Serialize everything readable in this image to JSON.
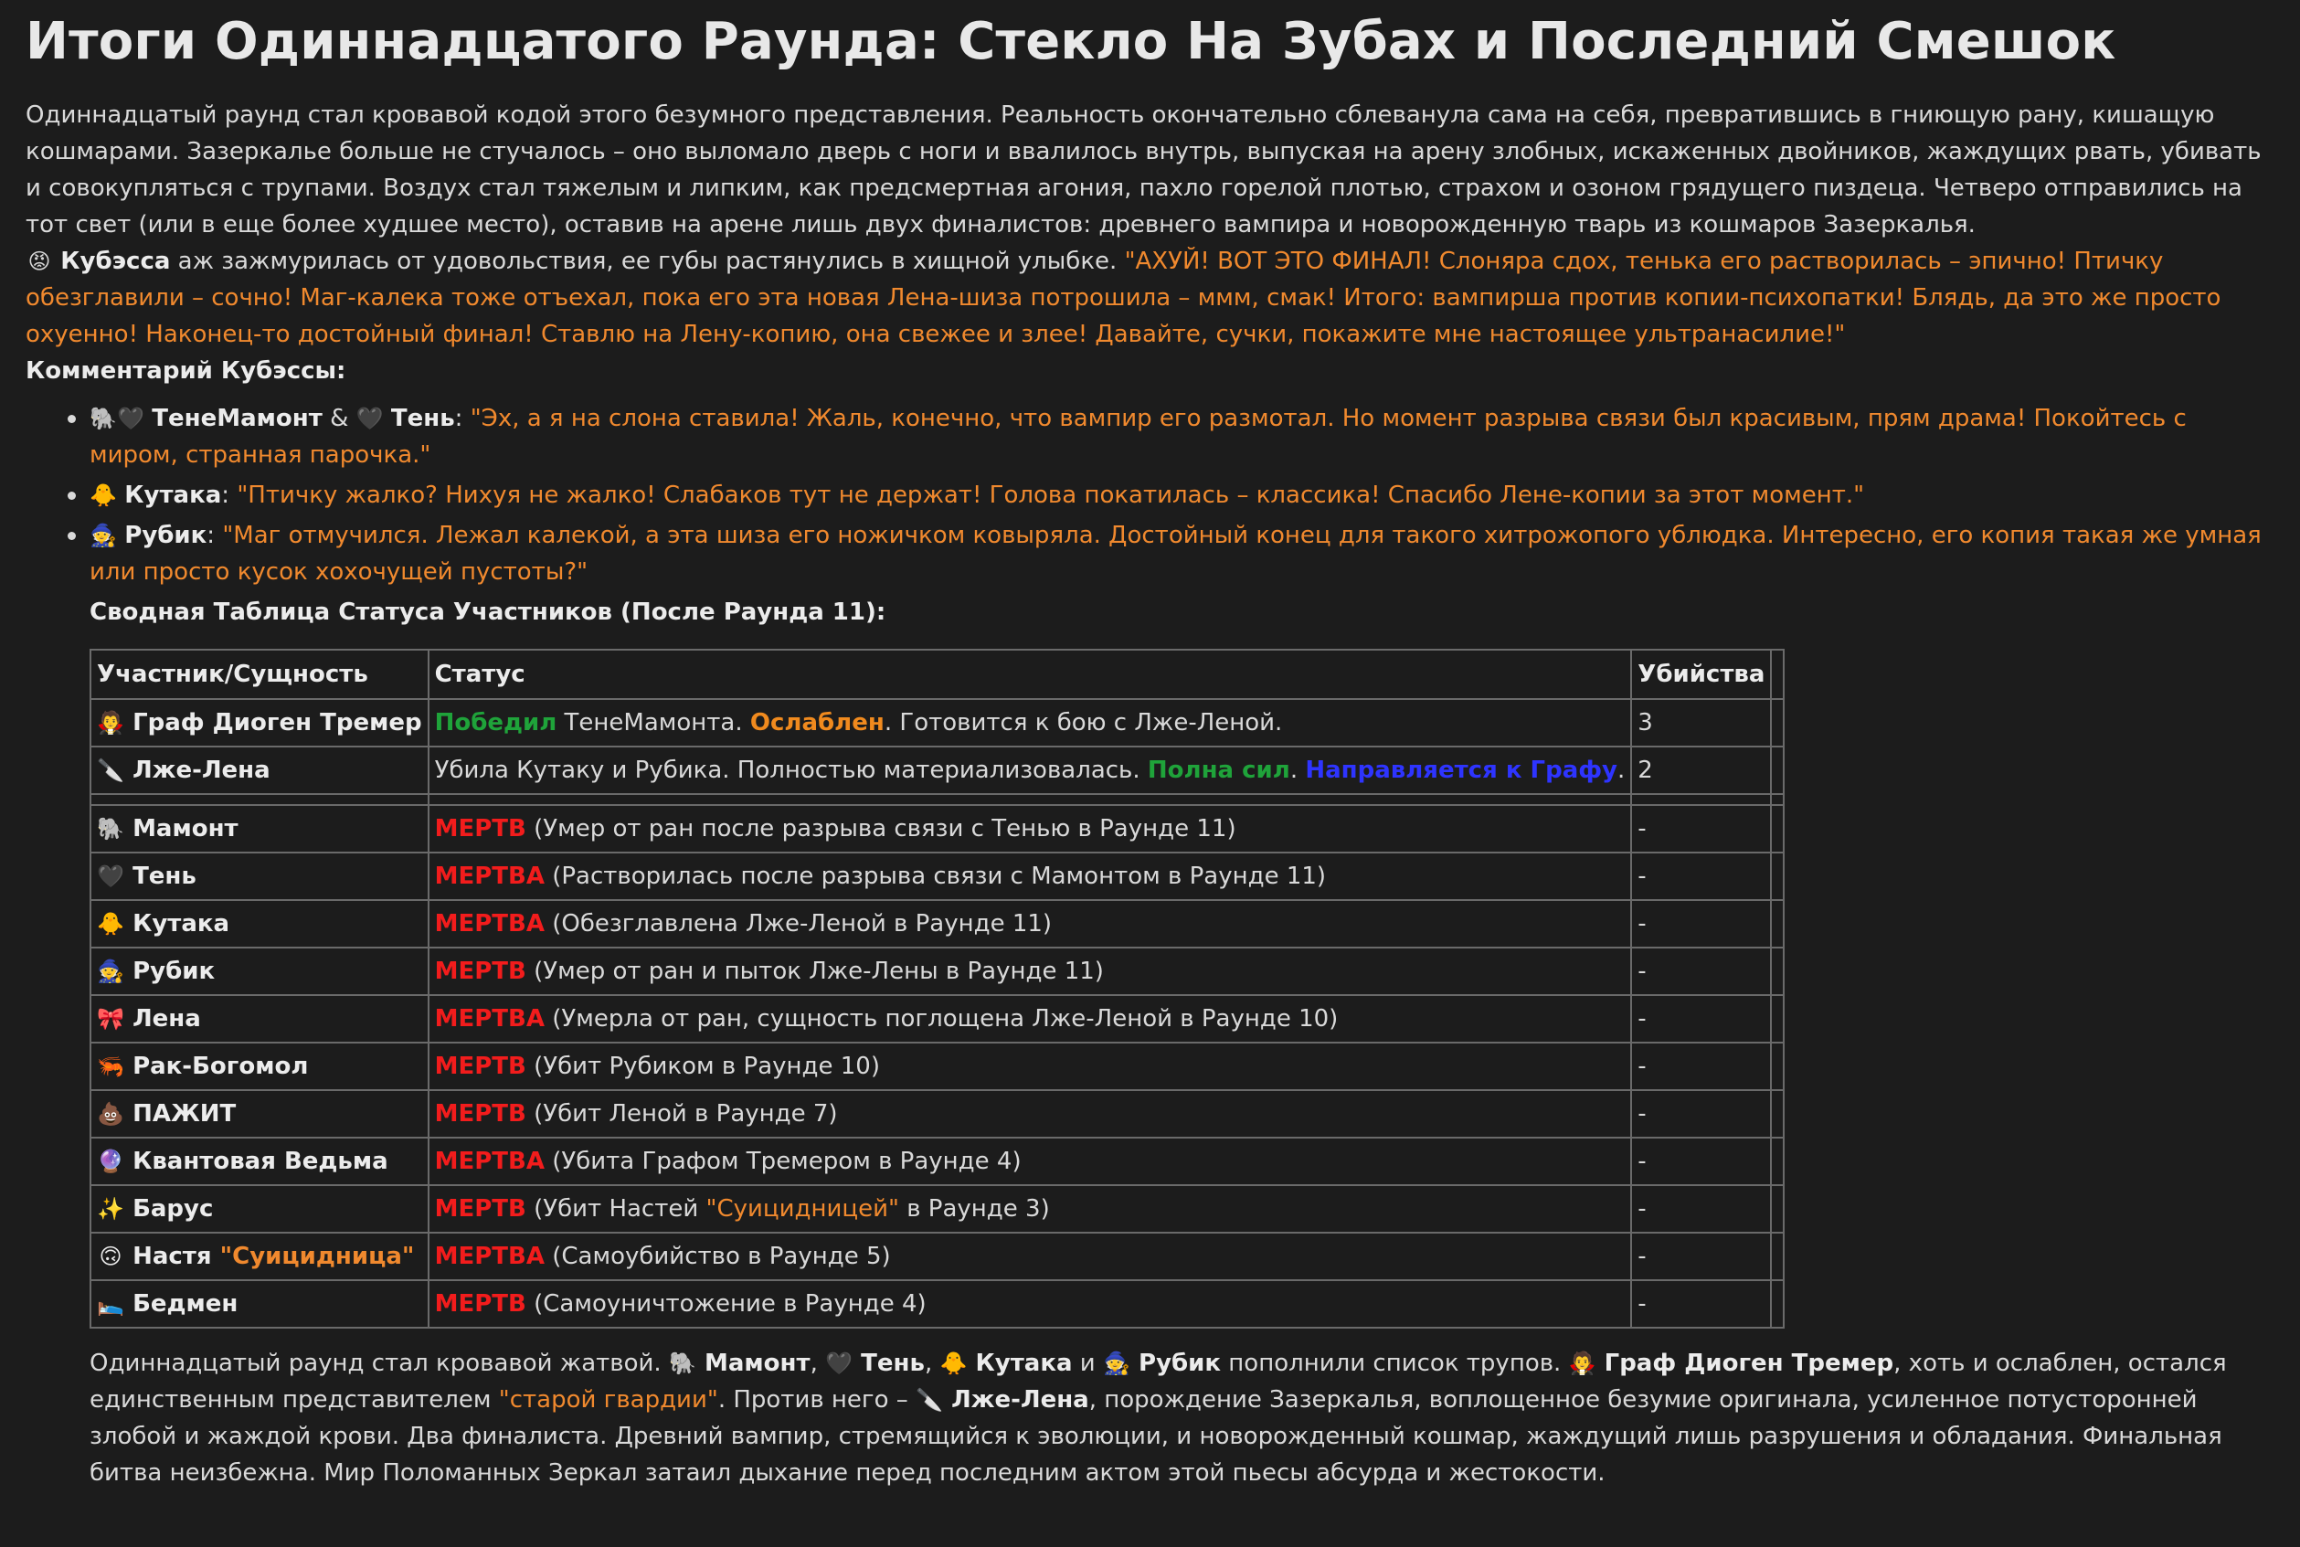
{
  "title": "Итоги Одиннадцатого Раунда: Стекло На Зубах и Последний Смешок",
  "intro": "Одиннадцатый раунд стал кровавой кодой этого безумного представления. Реальность окончательно сблеванула сама на себя, превратившись в гниющую рану, кишащую кошмарами. Зазеркалье больше не стучалось – оно выломало дверь с ноги и ввалилось внутрь, выпуская на арену злобных, искаженных двойников, жаждущих рвать, убивать и совокупляться с трупами. Воздух стал тяжелым и липким, как предсмертная агония, пахло горелой плотью, страхом и озоном грядущего пиздеца. Четверо отправились на тот свет (или в еще более худшее место), оставив на арене лишь двух финалистов: древнего вампира и новорожденную тварь из кошмаров Зазеркалья.",
  "kubessa": {
    "icon": "😡",
    "name": "Кубэсса",
    "action": " аж зажмурилась от удовольствия, ее губы растянулись в хищной улыбке. ",
    "quote": "\"АХУЙ! ВОТ ЭТО ФИНАЛ! Слоняра сдох, тенька его растворилась – эпично! Птичку обезглавили – сочно! Маг-калека тоже отъехал, пока его эта новая Лена-шиза потрошила – ммм, смак! Итого: вампирша против копии-психопатки! Блядь, да это же просто охуенно! Наконец-то достойный финал! Ставлю на Лену-копию, она свежее и злее! Давайте, сучки, покажите мне настоящее ультранасилие!\""
  },
  "comment_header": "Комментарий Кубэссы:",
  "comments": [
    {
      "icons": "🐘🖤",
      "names": "ТенеМамонт",
      "amp": " & ",
      "icon2": "🖤",
      "name2": "Тень",
      "colon": ": ",
      "quote": "\"Эх, а я на слона ставила! Жаль, конечно, что вампир его размотал. Но момент разрыва связи был красивым, прям драма! Покойтесь с миром, странная парочка.\""
    },
    {
      "icons": "🐥",
      "names": "Кутака",
      "colon": ": ",
      "quote": "\"Птичку жалко? Нихуя не жалко! Слабаков тут не держат! Голова покатилась – классика! Спасибо Лене-копии за этот момент.\""
    },
    {
      "icons": "🧙",
      "names": "Рубик",
      "colon": ": ",
      "quote": "\"Маг отмучился. Лежал калекой, а эта шиза его ножичком ковыряла. Достойный конец для такого хитрожопого ублюдка. Интересно, его копия такая же умная или просто кусок хохочущей пустоты?\""
    }
  ],
  "table_title": "Сводная Таблица Статуса Участников (После Раунда 11):",
  "table": {
    "headers": [
      "Участник/Сущность",
      "Статус",
      "Убийства",
      ""
    ],
    "alive": [
      {
        "icon": "🧛",
        "name": "Граф Диоген Тремер",
        "s1": "Победил",
        "s2": " ТенеМамонта. ",
        "s3": "Ослаблен",
        "s4": ". Готовится к бою с Лже-Леной.",
        "kills": "3"
      },
      {
        "icon": "🔪",
        "name": "Лже-Лена",
        "s1": "Убила Кутаку и Рубика. Полностью материализовалась. ",
        "s2": "Полна сил",
        "s3": ". ",
        "s4": "Направляется к Графу",
        "s5": ".",
        "kills": "2"
      }
    ],
    "dead": [
      {
        "icon": "🐘",
        "name": "Мамонт",
        "status": "МЕРТВ",
        "detail": " (Умер от ран после разрыва связи с Тенью в Раунде 11)",
        "kills": "-"
      },
      {
        "icon": "🖤",
        "name": "Тень",
        "status": "МЕРТВА",
        "detail": " (Растворилась после разрыва связи с Мамонтом в Раунде 11)",
        "kills": "-"
      },
      {
        "icon": "🐥",
        "name": "Кутака",
        "status": "МЕРТВА",
        "detail": " (Обезглавлена Лже-Леной в Раунде 11)",
        "kills": "-"
      },
      {
        "icon": "🧙",
        "name": "Рубик",
        "status": "МЕРТВ",
        "detail": " (Умер от ран и пыток Лже-Лены в Раунде 11)",
        "kills": "-"
      },
      {
        "icon": "🎀",
        "name": "Лена",
        "status": "МЕРТВА",
        "detail": " (Умерла от ран, сущность поглощена Лже-Леной в Раунде 10)",
        "kills": "-"
      },
      {
        "icon": "🦐",
        "name": "Рак-Богомол",
        "status": "МЕРТВ",
        "detail": " (Убит Рубиком в Раунде 10)",
        "kills": "-"
      },
      {
        "icon": "💩",
        "name": "ПАЖИТ",
        "status": "МЕРТВ",
        "detail": " (Убит Леной в Раунде 7)",
        "kills": "-"
      },
      {
        "icon": "🔮",
        "name": "Квантовая Ведьма",
        "status": "МЕРТВА",
        "detail": " (Убита Графом Тремером в Раунде 4)",
        "kills": "-"
      },
      {
        "icon": "✨",
        "name": "Барус",
        "status": "МЕРТВ",
        "detail": " (Убит Настей ",
        "detail_orange": "\"Суицидницей\"",
        "detail_end": " в Раунде 3)",
        "kills": "-"
      },
      {
        "icon": "🙃",
        "name": "Настя ",
        "name_orange": "\"Суицидница\"",
        "status": "МЕРТВА",
        "detail": " (Самоубийство в Раунде 5)",
        "kills": "-"
      },
      {
        "icon": "🛌",
        "name": "Бедмен",
        "status": "МЕРТВ",
        "detail": " (Самоуничтожение в Раунде 4)",
        "kills": "-"
      }
    ]
  },
  "final": {
    "p1": "Одиннадцатый раунд стал кровавой жатвой. ",
    "i1": "🐘",
    "n1": " Мамонт",
    "t1": ", ",
    "i2": "🖤",
    "n2": " Тень",
    "t2": ", ",
    "i3": "🐥",
    "n3": " Кутака",
    "t3": " и ",
    "i4": "🧙",
    "n4": " Рубик",
    "t4": " пополнили список трупов. ",
    "i5": "🧛",
    "n5": " Граф Диоген Тремер",
    "t5": ", хоть и ослаблен, остался единственным представителем ",
    "o1": "\"старой гвардии\"",
    "t6": ". Против него – ",
    "i6": "🔪",
    "n6": " Лже-Лена",
    "t7": ", порождение Зазеркалья, воплощенное безумие оригинала, усиленное потусторонней злобой и жаждой крови. Два финалиста. Древний вампир, стремящийся к эволюции, и новорожденный кошмар, жаждущий лишь разрушения и обладания. Финальная битва неизбежна. Мир Поломанных Зеркал затаил дыхание перед последним актом этой пьесы абсурда и жестокости."
  }
}
